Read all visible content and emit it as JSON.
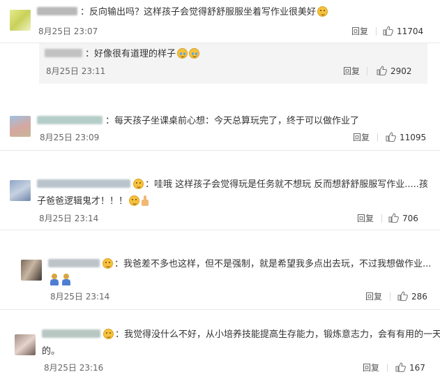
{
  "comments": [
    {
      "text": "：反向输出吗？这样孩子会觉得舒舒服服坐着写作业很美好",
      "time": "8月25日 23:07",
      "reply_label": "回复",
      "likes": "11704"
    },
    {
      "text": "：好像很有道理的样子",
      "time": "8月25日 23:11",
      "reply_label": "回复",
      "likes": "2902"
    },
    {
      "text": "：每天孩子坐课桌前心想：今天总算玩完了，终于可以做作业了",
      "time": "8月25日 23:09",
      "reply_label": "回复",
      "likes": "11095"
    },
    {
      "text_line1": "：哇哦 这样孩子会觉得玩是任务就不想玩 反而想舒舒服服写作业.....孩",
      "text_line2": "子爸爸逻辑鬼才！！！",
      "time": "8月25日 23:14",
      "reply_label": "回复",
      "likes": "706"
    },
    {
      "text": "：我爸差不多也这样，但不是强制，就是希望我多点出去玩，不过我想做作业...",
      "time": "8月25日 23:14",
      "reply_label": "回复",
      "likes": "286"
    },
    {
      "text_line1": "：我觉得没什么不好，从小培养技能提高生存能力，锻炼意志力，会有有用的一天",
      "text_line2": "的。",
      "time": "8月25日 23:16",
      "reply_label": "回复",
      "likes": "167"
    }
  ]
}
